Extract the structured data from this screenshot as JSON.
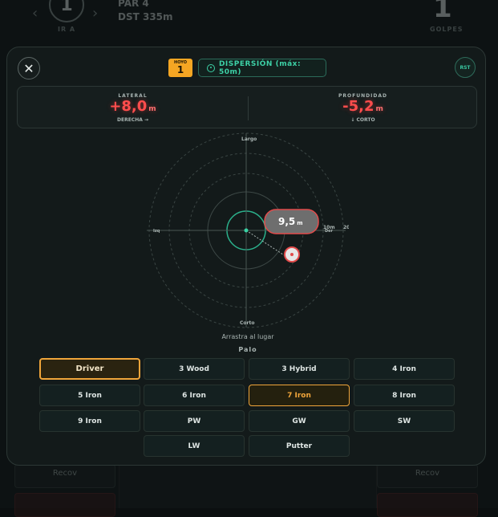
{
  "background": {
    "hole_number": "1",
    "hole_sub": "IR A",
    "par_text": "PAR 4",
    "dist_text": "DST 335m",
    "strokes": "1",
    "strokes_sub": "GOLPES",
    "left_card": "Recov",
    "right_card": "Recov"
  },
  "header": {
    "hole_label": "HOYO",
    "hole_number": "1",
    "dispersion_label": "DISPERSIÓN (máx: 50m)",
    "reset_label": "RST"
  },
  "stats": {
    "lateral": {
      "title": "LATERAL",
      "value": "+8,0",
      "unit": "m",
      "sub": "DERECHA →"
    },
    "depth": {
      "title": "PROFUNDIDAD",
      "value": "-5,2",
      "unit": "m",
      "sub": "↓ CORTO"
    }
  },
  "target": {
    "label_top": "Largo",
    "label_bottom": "Corto",
    "label_left": "Izq",
    "label_right": "Der",
    "ring_10": "10m",
    "ring_20": "20m",
    "distance_value": "9,5",
    "distance_unit": "m",
    "drag_hint": "Arrastra al lugar"
  },
  "clubs": {
    "title": "Palo",
    "items": [
      "Driver",
      "3 Wood",
      "3 Hybrid",
      "4 Iron",
      "5 Iron",
      "6 Iron",
      "7 Iron",
      "8 Iron",
      "9 Iron",
      "PW",
      "GW",
      "SW",
      "LW",
      "Putter"
    ],
    "selected": "Driver",
    "highlighted": "7 Iron"
  },
  "colors": {
    "accent_green": "#3dd1a6",
    "accent_amber": "#f0a53a",
    "error_red": "#ff4d4d"
  }
}
